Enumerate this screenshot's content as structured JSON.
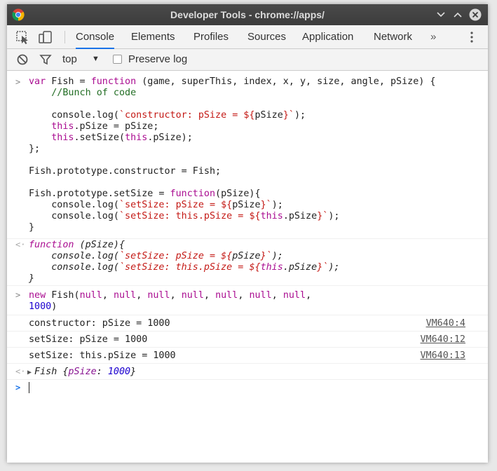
{
  "window": {
    "title": "Developer Tools - chrome://apps/"
  },
  "tabs": [
    {
      "label": "Console",
      "active": true
    },
    {
      "label": "Elements"
    },
    {
      "label": "Profiles"
    },
    {
      "label": "Sources"
    },
    {
      "label": "Application"
    },
    {
      "label": "Network"
    }
  ],
  "tabbar": {
    "more_label": "»"
  },
  "filterbar": {
    "context": "top",
    "preserve_log_label": "Preserve log",
    "preserve_log_checked": false
  },
  "console": {
    "input1_lines": [
      "var Fish = function (game, superThis, index, x, y, size, angle, pSize) {",
      "    //Bunch of code",
      "",
      "    console.log(`constructor: pSize = ${pSize}`);",
      "    this.pSize = pSize;",
      "    this.setSize(this.pSize);",
      "};",
      "",
      "Fish.prototype.constructor = Fish;",
      "",
      "Fish.prototype.setSize = function(pSize){",
      "    console.log(`setSize: pSize = ${pSize}`);",
      "    console.log(`setSize: this.pSize = ${this.pSize}`);",
      "}"
    ],
    "result1_lines": [
      "function (pSize){",
      "    console.log(`setSize: pSize = ${pSize}`);",
      "    console.log(`setSize: this.pSize = ${this.pSize}`);",
      "}"
    ],
    "input2_lines": [
      "new Fish(null, null, null, null, null, null, null,",
      "1000)"
    ],
    "logs": [
      {
        "text": "constructor: pSize = 1000",
        "source": "VM640:4"
      },
      {
        "text": "setSize: pSize = 1000",
        "source": "VM640:12"
      },
      {
        "text": "setSize: this.pSize = 1000",
        "source": "VM640:13"
      }
    ],
    "result2": {
      "class_name": "Fish",
      "prop": "pSize",
      "value": "1000"
    }
  },
  "colors": {
    "keyword": "#aa0d91",
    "string": "#c41a16",
    "comment": "#236e25",
    "number": "#1c00cf",
    "accent": "#1a73e8"
  }
}
